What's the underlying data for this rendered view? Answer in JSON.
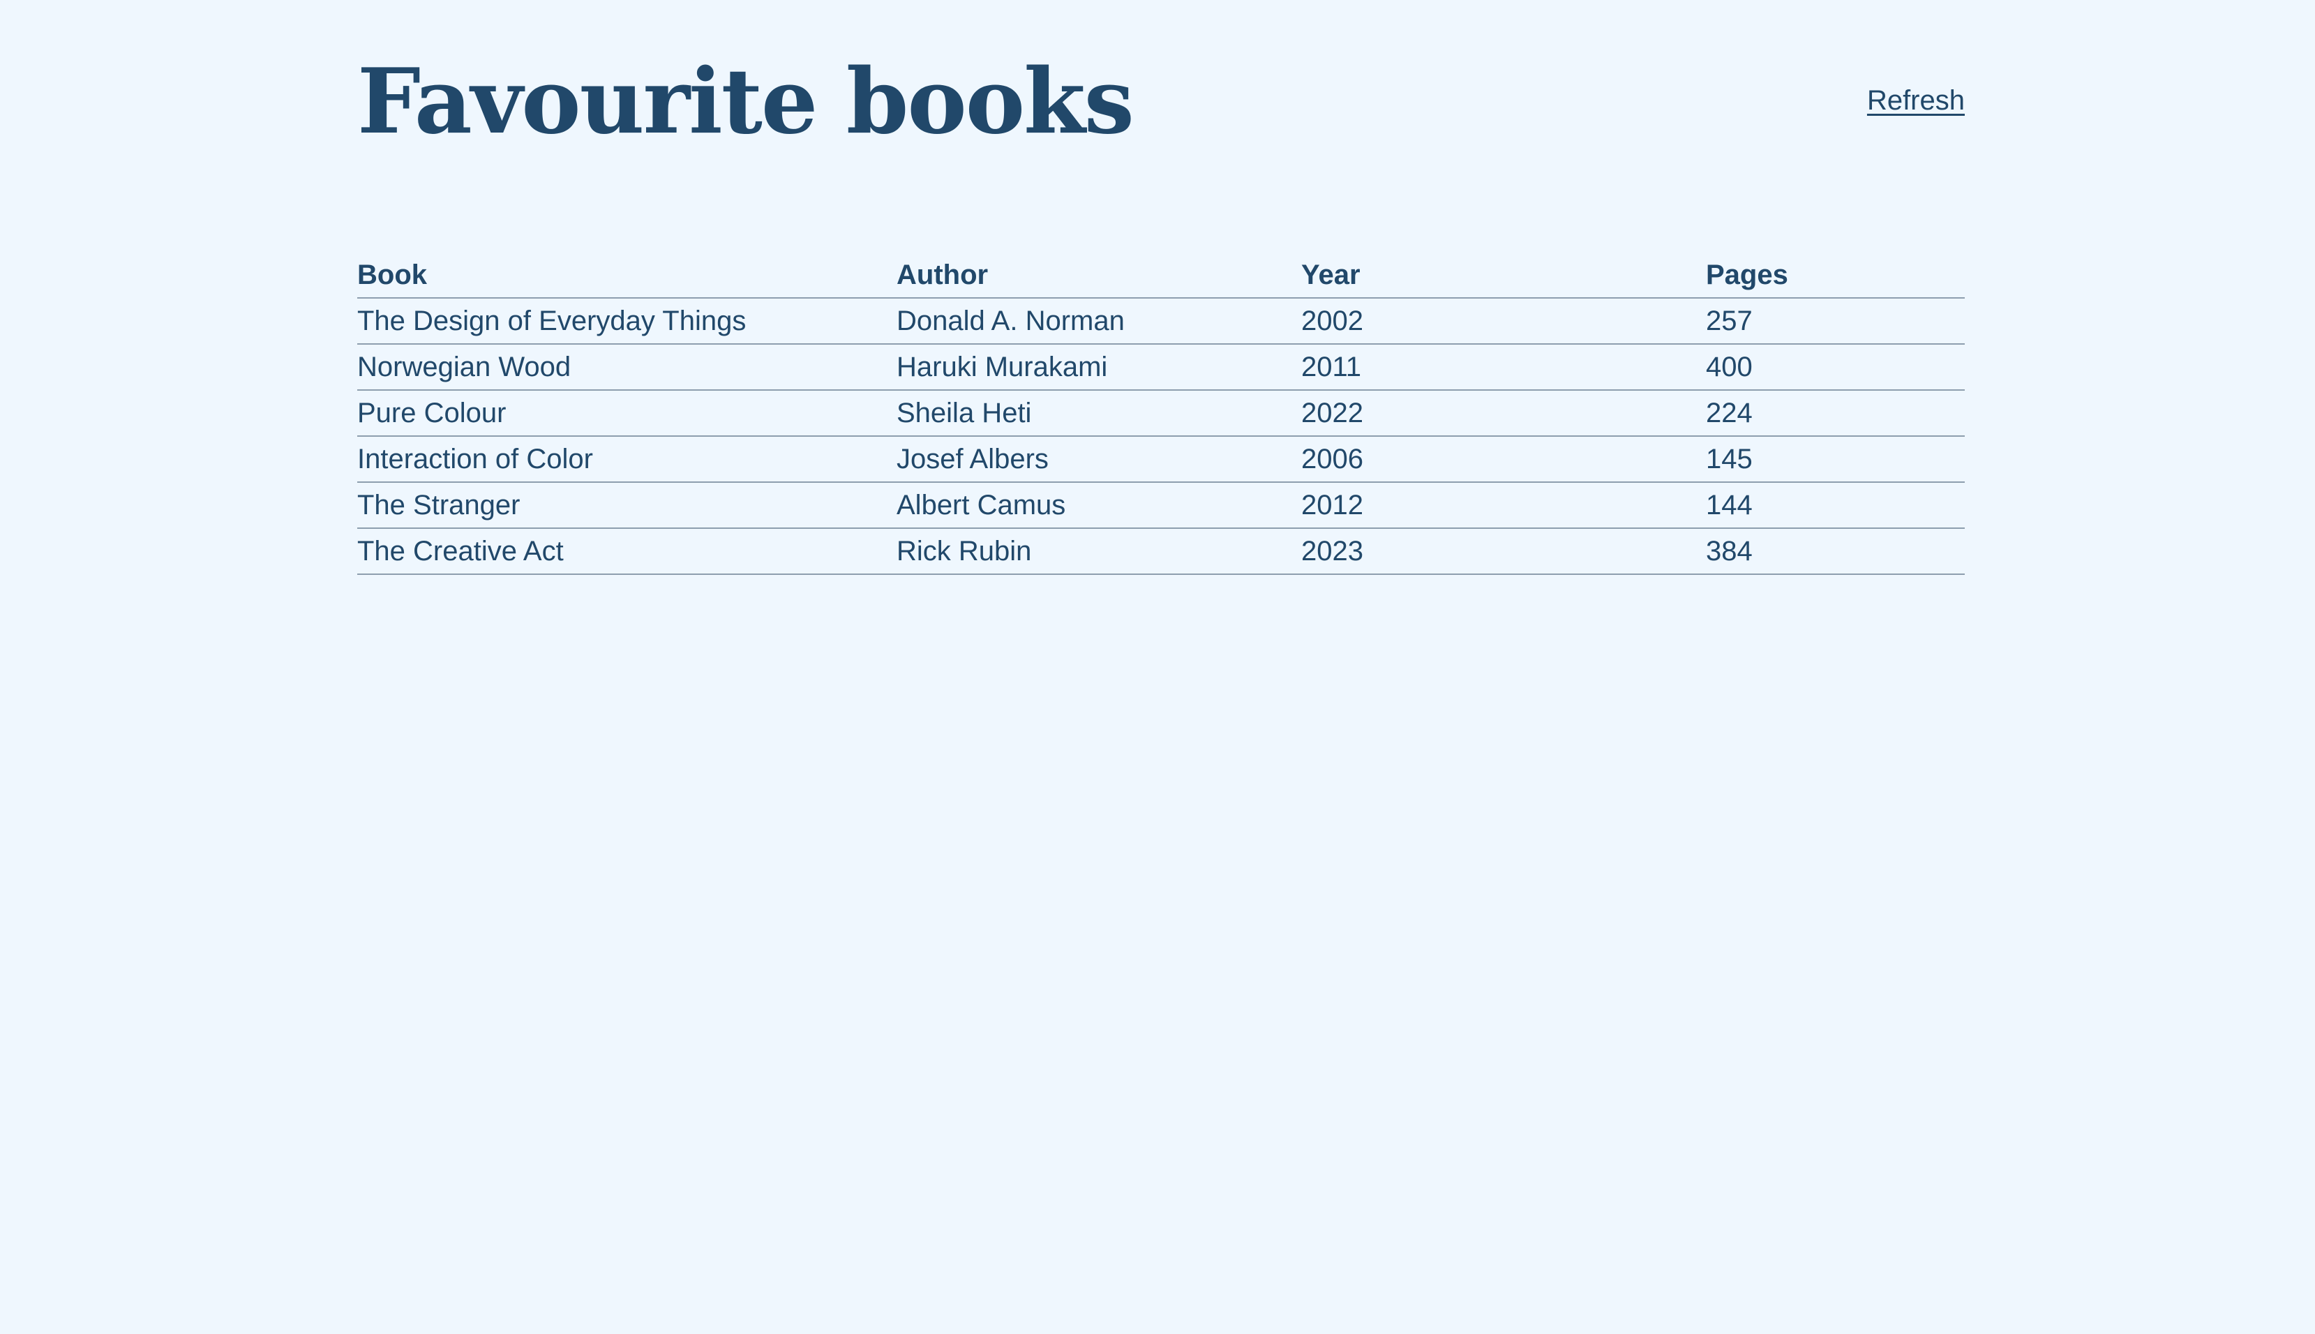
{
  "page": {
    "title": "Favourite books",
    "refresh_label": "Refresh"
  },
  "table": {
    "headers": [
      "Book",
      "Author",
      "Year",
      "Pages"
    ],
    "rows": [
      [
        "The Design of Everyday Things",
        "Donald A. Norman",
        "2002",
        "257"
      ],
      [
        "Norwegian Wood",
        "Haruki Murakami",
        "2011",
        "400"
      ],
      [
        "Pure Colour",
        "Sheila Heti",
        "2022",
        "224"
      ],
      [
        "Interaction of Color",
        "Josef Albers",
        "2006",
        "145"
      ],
      [
        "The Stranger",
        "Albert Camus",
        "2012",
        "144"
      ],
      [
        "The Creative Act",
        "Rick Rubin",
        "2023",
        "384"
      ]
    ]
  },
  "colors": {
    "background": "#eff7fe",
    "text": "#21486a",
    "rule": "#8d9eae"
  }
}
